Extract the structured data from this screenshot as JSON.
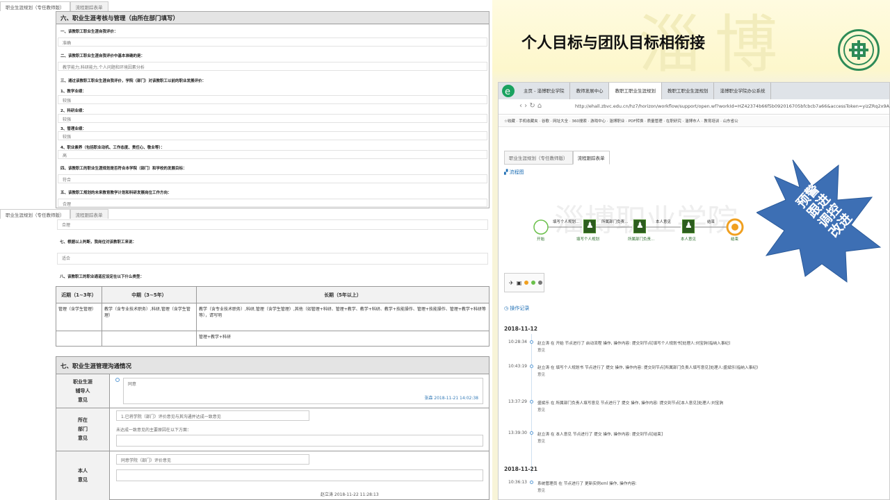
{
  "left": {
    "top_tabs": [
      "职业生涯规划（专任教师版）",
      "流程跟踪表单"
    ],
    "mid_tabs": [
      "职业生涯规划（专任教师版）",
      "流程跟踪表单"
    ],
    "section6_title": "六、职业生涯考核与管理（由所在部门填写）",
    "questions": [
      {
        "q": "一、该教职工职业生涯自我评价：",
        "a": "准确"
      },
      {
        "q": "二、该教职工职业生涯自我评价中基本准确的是：",
        "a": "教学能力,科研能力,个人问题和环境因素分析"
      },
      {
        "q": "三、通过该教职工职业生涯自我评价，学院（部门）对该教职工以前的职业发展评价：",
        "a": ""
      },
      {
        "q": "1、教学业绩：",
        "a": "较强"
      },
      {
        "q": "2、科研业绩：",
        "a": "较强"
      },
      {
        "q": "3、管理业绩：",
        "a": "较强"
      },
      {
        "q": "4、职业素养（包括职业动机、工作态度、责任心、敬业等）：",
        "a": "高"
      },
      {
        "q": "四、该教职工的职业生涯规划是否符合本学院（部门）和学校的发展目标：",
        "a": "符合"
      },
      {
        "q": "五、该教职工规划的未来教育教学计划和科研发展岗位工作方向：",
        "a": "合理"
      }
    ],
    "q5_answer": "合理",
    "q7": "七、根据以上判断，我岗位对该教职工来说：",
    "q7_answer": "适合",
    "q8": "八、该教职工的职业通道应设定在以下什么类型：",
    "table_headers": [
      "近期（1~3年）",
      "中期（3~5年）",
      "长期（5年以上）"
    ],
    "table_row1": [
      "管理（含学生管理）",
      "教学（含专业技术职务）,科研,管理（含学生管理）",
      "教学（含专业技术职务）,科研,管理（含学生管理）,其他（如管理+科研、管理+教学、教学+科研、教学+技能操作、管理+技能操作、管理+教学+科研等等），请写明"
    ],
    "table_row2": [
      "",
      "",
      "管理+教学+科研"
    ],
    "section7_title": "七、职业生涯管理沟通情况",
    "row_a_label": "职业生涯\n辅导人\n意见",
    "row_a_text": "同意",
    "row_a_sign": "张森 2018-11-21 14:02:38",
    "row_b_label": "所在\n部门\n意见",
    "row_b_text1": "1.已将学院（部门）评价意见与其沟通并达成一致意见",
    "row_b_text2": "未达成一致意见的主要原因在以下方面：",
    "row_c_label": "本人\n意见",
    "row_c_text": "同意学院（部门）评价意见",
    "row_c_sign": "赵立涛 2018-11-22 11:28:13"
  },
  "right": {
    "title": "个人目标与团队目标相衔接",
    "browser_tabs": [
      "主页 - 淄博职业学院",
      "教师发展中心",
      "教职工职业生涯规划",
      "教职工职业生涯规划",
      "淄博职业学院办公系统"
    ],
    "url": "http://ehall.zbvc.edu.cn/hz7/horizon/workflow/support/open.wf?workId=HZ42374b66f5b092016705bfcbcb7a66&accessToken=yizZRq2x9A0wN%2f12",
    "favorites": "☆收藏 · 手机收藏夹 · 谷歌 · 网址大全 · 360搜索 · 游戏中心 · 淄博职业 · PDF转换 · 质量管理 · 在职研究 · 淄博市人 · 教育培训 · 山东省公",
    "inner_tabs": [
      "职业生涯规划（专任教师版）",
      "流程跟踪表单"
    ],
    "flow_heading": "流程图",
    "flow_nodes": [
      "开始",
      "填写个人规划",
      "所属部门负责...",
      "本人意见",
      "结束"
    ],
    "flow_edges": [
      "填写个人规划...",
      "所属部门负责...",
      "本人意见",
      "结束"
    ],
    "ops_heading": "操作记录",
    "date1": "2018-11-12",
    "date2": "2018-11-21",
    "logs": [
      {
        "time": "10:28:34",
        "text": "赵立涛 在 开始 节点进行了 启动流程 操作, 操作内容: 提交到节点[填写个人规划书]处理人:刘宝驹(指纳入事纪)",
        "op": "意见"
      },
      {
        "time": "10:43:19",
        "text": "赵立涛 在 填写个人规划书 节点进行了 提交 操作, 操作内容: 提交到节点[所属部门负责人填写意见]处理人:盛斌乐(指纳入事纪)",
        "op": "意见"
      },
      {
        "time": "13:37:29",
        "text": "盛斌乐 在 所属部门负责人填写意见 节点进行了 提交 操作, 操作内容: 提交到节点[本人意见]处理人:刘宝驹",
        "op": "意见"
      },
      {
        "time": "13:39:30",
        "text": "赵立涛 在 本人意见 节点进行了 提交 操作, 操作内容: 提交到节点[结束]",
        "op": "意见"
      },
      {
        "time": "10:36:13",
        "text": "系统管理员 在 节点进行了 更新实例xml 操作, 操作内容:",
        "op": "意见"
      }
    ],
    "star_text": "预警\n跟进\n调控\n改进",
    "colors": {
      "accent": "#1f6fb5",
      "star": "#3d6fb4",
      "node": "#2d5d1f",
      "end": "#f0a020"
    }
  }
}
